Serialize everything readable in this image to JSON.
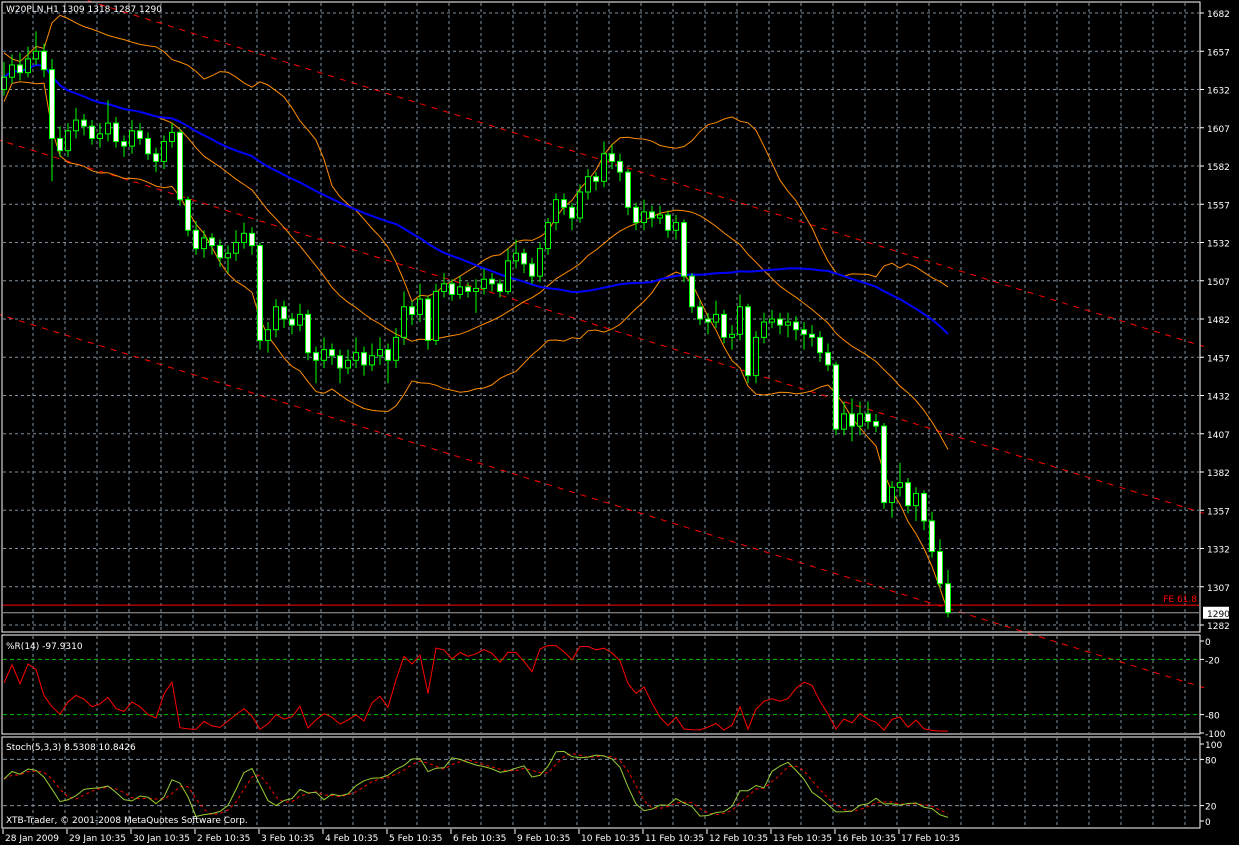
{
  "header": {
    "symbol": "W20PLN,H1",
    "open": "1309",
    "high": "1318",
    "low": "1287",
    "close": "1290"
  },
  "colors": {
    "background": "#000000",
    "candle_outline": "#00ff00",
    "bear_body": "#ffffff",
    "bull_body": "#000000",
    "grid": "#8090a0",
    "bollinger": "#ff8c00",
    "moving_average": "#0000ff",
    "channel": "#ff0000",
    "williams_r": "#ff0000",
    "stoch_main": "#9acd32",
    "stoch_signal": "#ff0000",
    "level_lines": "#00c000"
  },
  "chart_data": [
    {
      "type": "candlestick",
      "title": "W20PLN,H1 1309 1318 1287 1290",
      "ylim": [
        1282,
        1682
      ],
      "y_ticks": [
        1682,
        1657,
        1632,
        1607,
        1582,
        1557,
        1532,
        1507,
        1482,
        1457,
        1432,
        1407,
        1382,
        1357,
        1332,
        1307,
        1282
      ],
      "x_tick_labels": [
        "28 Jan 2009",
        "29 Jan 10:35",
        "30 Jan 10:35",
        "2 Feb 10:35",
        "3 Feb 10:35",
        "4 Feb 10:35",
        "5 Feb 10:35",
        "6 Feb 10:35",
        "9 Feb 10:35",
        "10 Feb 10:35",
        "11 Feb 10:35",
        "12 Feb 10:35",
        "13 Feb 10:35",
        "16 Feb 10:35",
        "17 Feb 10:35"
      ],
      "bars_per_x_label": 8,
      "grid": true,
      "current_price": "1290",
      "horizontal_lines": [
        {
          "label": "FE 61.8",
          "price": 1295
        }
      ],
      "channel_lines_price_at_first_bar": [
        1707,
        1598,
        1484
      ],
      "channel_slope_per_bar": -1.62,
      "ohlc": [
        [
          1632,
          1650,
          1628,
          1640
        ],
        [
          1640,
          1655,
          1636,
          1648
        ],
        [
          1648,
          1656,
          1638,
          1643
        ],
        [
          1643,
          1660,
          1640,
          1652
        ],
        [
          1652,
          1670,
          1648,
          1657
        ],
        [
          1657,
          1662,
          1640,
          1645
        ],
        [
          1645,
          1652,
          1572,
          1600
        ],
        [
          1600,
          1608,
          1588,
          1592
        ],
        [
          1592,
          1610,
          1588,
          1605
        ],
        [
          1605,
          1620,
          1600,
          1612
        ],
        [
          1612,
          1616,
          1602,
          1608
        ],
        [
          1608,
          1612,
          1596,
          1600
        ],
        [
          1600,
          1610,
          1594,
          1603
        ],
        [
          1603,
          1625,
          1598,
          1610
        ],
        [
          1610,
          1614,
          1594,
          1598
        ],
        [
          1598,
          1602,
          1588,
          1595
        ],
        [
          1595,
          1612,
          1590,
          1605
        ],
        [
          1605,
          1610,
          1596,
          1600
        ],
        [
          1600,
          1604,
          1586,
          1590
        ],
        [
          1590,
          1594,
          1578,
          1585
        ],
        [
          1585,
          1602,
          1580,
          1598
        ],
        [
          1598,
          1610,
          1594,
          1604
        ],
        [
          1604,
          1606,
          1556,
          1560
        ],
        [
          1560,
          1562,
          1536,
          1540
        ],
        [
          1540,
          1546,
          1524,
          1528
        ],
        [
          1528,
          1540,
          1522,
          1535
        ],
        [
          1535,
          1538,
          1524,
          1530
        ],
        [
          1530,
          1534,
          1516,
          1522
        ],
        [
          1522,
          1530,
          1512,
          1525
        ],
        [
          1525,
          1540,
          1520,
          1532
        ],
        [
          1532,
          1545,
          1528,
          1538
        ],
        [
          1538,
          1542,
          1524,
          1530
        ],
        [
          1530,
          1532,
          1462,
          1468
        ],
        [
          1468,
          1480,
          1460,
          1475
        ],
        [
          1475,
          1495,
          1470,
          1490
        ],
        [
          1490,
          1494,
          1476,
          1482
        ],
        [
          1482,
          1486,
          1472,
          1478
        ],
        [
          1478,
          1492,
          1474,
          1485
        ],
        [
          1485,
          1488,
          1455,
          1460
        ],
        [
          1460,
          1464,
          1440,
          1455
        ],
        [
          1455,
          1470,
          1450,
          1462
        ],
        [
          1462,
          1466,
          1452,
          1458
        ],
        [
          1458,
          1462,
          1440,
          1450
        ],
        [
          1450,
          1462,
          1446,
          1455
        ],
        [
          1455,
          1470,
          1450,
          1460
        ],
        [
          1460,
          1464,
          1445,
          1452
        ],
        [
          1452,
          1466,
          1448,
          1458
        ],
        [
          1458,
          1470,
          1452,
          1462
        ],
        [
          1462,
          1466,
          1440,
          1455
        ],
        [
          1455,
          1476,
          1450,
          1470
        ],
        [
          1470,
          1500,
          1465,
          1490
        ],
        [
          1490,
          1494,
          1478,
          1485
        ],
        [
          1485,
          1505,
          1480,
          1495
        ],
        [
          1495,
          1497,
          1462,
          1468
        ],
        [
          1468,
          1505,
          1465,
          1500
        ],
        [
          1500,
          1512,
          1496,
          1505
        ],
        [
          1505,
          1508,
          1494,
          1498
        ],
        [
          1498,
          1510,
          1495,
          1503
        ],
        [
          1503,
          1506,
          1496,
          1500
        ],
        [
          1500,
          1508,
          1486,
          1502
        ],
        [
          1502,
          1515,
          1498,
          1508
        ],
        [
          1508,
          1512,
          1500,
          1505
        ],
        [
          1505,
          1508,
          1496,
          1500
        ],
        [
          1500,
          1528,
          1498,
          1520
        ],
        [
          1520,
          1534,
          1515,
          1525
        ],
        [
          1525,
          1528,
          1512,
          1518
        ],
        [
          1518,
          1522,
          1505,
          1510
        ],
        [
          1510,
          1532,
          1506,
          1528
        ],
        [
          1528,
          1548,
          1524,
          1545
        ],
        [
          1545,
          1564,
          1540,
          1560
        ],
        [
          1560,
          1564,
          1550,
          1555
        ],
        [
          1555,
          1558,
          1540,
          1548
        ],
        [
          1548,
          1570,
          1545,
          1565
        ],
        [
          1565,
          1580,
          1560,
          1575
        ],
        [
          1575,
          1578,
          1566,
          1572
        ],
        [
          1572,
          1598,
          1568,
          1590
        ],
        [
          1590,
          1596,
          1580,
          1585
        ],
        [
          1585,
          1590,
          1572,
          1578
        ],
        [
          1578,
          1580,
          1550,
          1555
        ],
        [
          1555,
          1558,
          1540,
          1545
        ],
        [
          1545,
          1560,
          1540,
          1552
        ],
        [
          1552,
          1556,
          1542,
          1548
        ],
        [
          1548,
          1556,
          1544,
          1550
        ],
        [
          1550,
          1553,
          1535,
          1540
        ],
        [
          1540,
          1550,
          1534,
          1545
        ],
        [
          1545,
          1547,
          1506,
          1510
        ],
        [
          1510,
          1512,
          1486,
          1490
        ],
        [
          1490,
          1494,
          1478,
          1482
        ],
        [
          1482,
          1486,
          1472,
          1480
        ],
        [
          1480,
          1494,
          1476,
          1485
        ],
        [
          1485,
          1488,
          1466,
          1470
        ],
        [
          1470,
          1478,
          1462,
          1472
        ],
        [
          1472,
          1498,
          1468,
          1490
        ],
        [
          1490,
          1492,
          1440,
          1445
        ],
        [
          1445,
          1474,
          1440,
          1470
        ],
        [
          1470,
          1486,
          1466,
          1480
        ],
        [
          1480,
          1488,
          1476,
          1482
        ],
        [
          1482,
          1486,
          1472,
          1478
        ],
        [
          1478,
          1486,
          1470,
          1480
        ],
        [
          1480,
          1484,
          1468,
          1475
        ],
        [
          1475,
          1480,
          1462,
          1472
        ],
        [
          1472,
          1478,
          1464,
          1470
        ],
        [
          1470,
          1474,
          1454,
          1460
        ],
        [
          1460,
          1466,
          1448,
          1452
        ],
        [
          1452,
          1454,
          1406,
          1410
        ],
        [
          1410,
          1428,
          1406,
          1420
        ],
        [
          1420,
          1430,
          1402,
          1412
        ],
        [
          1412,
          1428,
          1406,
          1420
        ],
        [
          1420,
          1428,
          1410,
          1415
        ],
        [
          1415,
          1420,
          1408,
          1412
        ],
        [
          1412,
          1414,
          1358,
          1362
        ],
        [
          1362,
          1376,
          1352,
          1372
        ],
        [
          1372,
          1388,
          1366,
          1375
        ],
        [
          1375,
          1378,
          1355,
          1360
        ],
        [
          1360,
          1372,
          1350,
          1368
        ],
        [
          1368,
          1370,
          1344,
          1350
        ],
        [
          1350,
          1356,
          1326,
          1330
        ],
        [
          1330,
          1338,
          1306,
          1309
        ],
        [
          1309,
          1318,
          1287,
          1290
        ]
      ]
    },
    {
      "type": "line",
      "label": "%R(14) -97.9310",
      "ylim": [
        -100,
        0
      ],
      "y_ticks": [
        0,
        -20,
        -80,
        -100
      ],
      "levels": [
        -20,
        -80
      ]
    },
    {
      "type": "line",
      "label": "Stoch(5,3,3) 8.5308 10.8426",
      "ylim": [
        0,
        100
      ],
      "y_ticks": [
        100,
        80,
        20,
        0
      ],
      "levels": [
        80,
        20
      ]
    }
  ],
  "footer": {
    "copyright": "XTB-Trader, © 2001-2008 MetaQuotes Software Corp."
  }
}
